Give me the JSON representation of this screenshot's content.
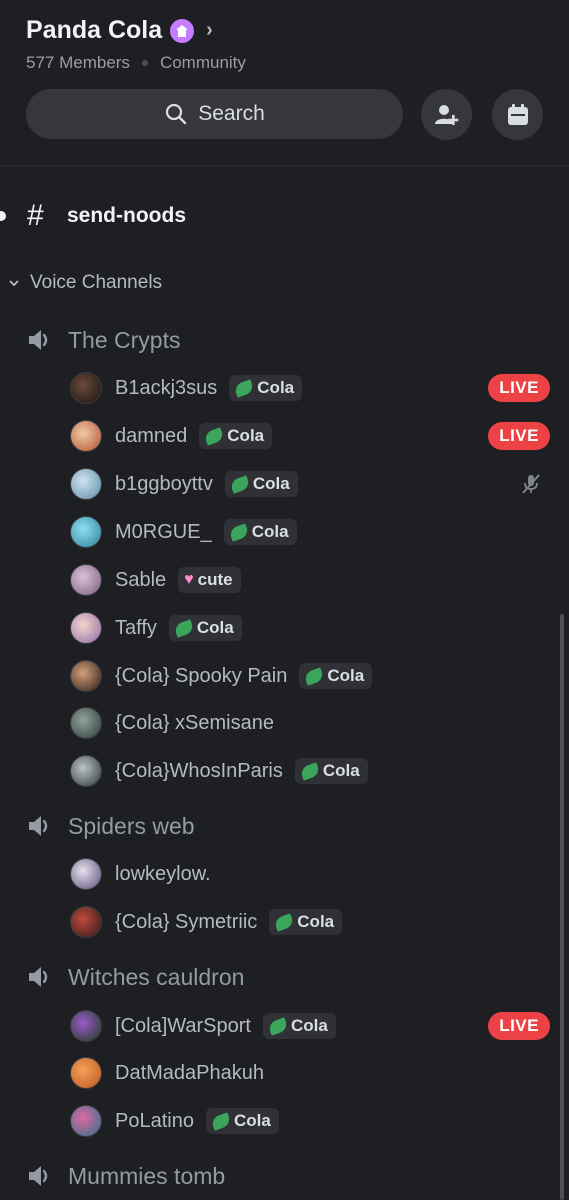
{
  "server": {
    "name": "Panda Cola",
    "members": "577 Members",
    "type": "Community"
  },
  "search": {
    "label": "Search"
  },
  "channels": {
    "text_channel": "send-noods",
    "category": "Voice Channels"
  },
  "voice_channels": [
    {
      "name": "The Crypts",
      "users": [
        {
          "name": "B1ackj3sus",
          "tag": "Cola",
          "tag_icon": "leaf",
          "status": "LIVE"
        },
        {
          "name": "damned",
          "tag": "Cola",
          "tag_icon": "leaf",
          "status": "LIVE"
        },
        {
          "name": "b1ggboyttv",
          "tag": "Cola",
          "tag_icon": "leaf",
          "status": "muted"
        },
        {
          "name": "M0RGUE_",
          "tag": "Cola",
          "tag_icon": "leaf",
          "status": ""
        },
        {
          "name": "Sable",
          "tag": "cute",
          "tag_icon": "heart",
          "status": ""
        },
        {
          "name": "Taffy",
          "tag": "Cola",
          "tag_icon": "leaf",
          "status": ""
        },
        {
          "name": "{Cola} Spooky Pain",
          "tag": "Cola",
          "tag_icon": "leaf",
          "status": ""
        },
        {
          "name": "{Cola} xSemisane",
          "tag": "",
          "tag_icon": "",
          "status": ""
        },
        {
          "name": "{Cola}WhosInParis",
          "tag": "Cola",
          "tag_icon": "leaf",
          "status": ""
        }
      ]
    },
    {
      "name": "Spiders web",
      "users": [
        {
          "name": "lowkeylow.",
          "tag": "",
          "tag_icon": "",
          "status": ""
        },
        {
          "name": "{Cola} Symetriic",
          "tag": "Cola",
          "tag_icon": "leaf",
          "status": ""
        }
      ]
    },
    {
      "name": "Witches cauldron",
      "users": [
        {
          "name": "[Cola]WarSport",
          "tag": "Cola",
          "tag_icon": "leaf",
          "status": "LIVE"
        },
        {
          "name": "DatMadaPhakuh",
          "tag": "",
          "tag_icon": "",
          "status": ""
        },
        {
          "name": "PoLatino",
          "tag": "Cola",
          "tag_icon": "leaf",
          "status": ""
        }
      ]
    },
    {
      "name": "Mummies tomb",
      "users": []
    }
  ],
  "colors": {
    "background": "#1e1f22",
    "live": "#ed4245",
    "boost_badge": "#c77dff",
    "leaf": "#3ba55c"
  }
}
